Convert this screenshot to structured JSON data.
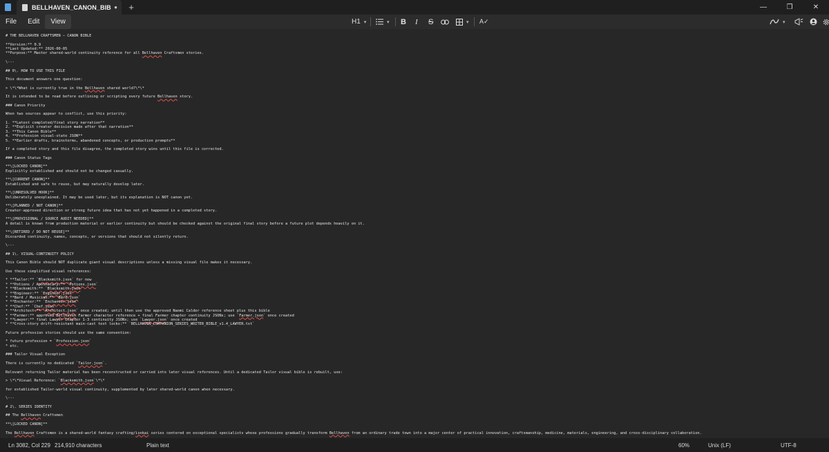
{
  "tab": {
    "title": "BELLHAVEN_CANON_BIBLE_UPDATI",
    "modified_dot": "●",
    "close": "✕",
    "add": "+"
  },
  "window": {
    "minimize": "—",
    "maximize": "❐",
    "close": "✕"
  },
  "menu": {
    "file": "File",
    "edit": "Edit",
    "view": "View"
  },
  "toolbar": {
    "heading": "H1",
    "bold": "B",
    "italic": "I",
    "strike": "S",
    "link": "⛓",
    "table": "⊞",
    "spellcheck": "A✓",
    "caret": "▾"
  },
  "icons": {
    "app": "notepad-icon",
    "list": "bullet-list-icon",
    "copilot": "copilot-icon",
    "settings": "gear-icon",
    "account": "account-icon",
    "share": "megaphone-icon"
  },
  "document": {
    "lines": [
      "# THE BELLHAVEN CRAFTSMEN — CANON BIBLE",
      "",
      "**Version:** 0.9",
      "**Last Updated:** 2026-00-05",
      "**Purpose:** Master shared-world continuity reference for all Bellhaven Craftsmen stories.",
      "",
      "\\---",
      "",
      "## 0\\. HOW TO USE THIS FILE",
      "",
      "This document answers one question:",
      "",
      "> \\*\\*What is currently true in the Bellhaven shared world?\\*\\*",
      "",
      "It is intended to be read before outlining or scripting every future Bellhaven story.",
      "",
      "### Canon Priority",
      "",
      "When two sources appear to conflict, use this priority:",
      "",
      "1. **Latest completed/final story narration**",
      "2. **Explicit creator decision made after that narration**",
      "3. **This Canon Bible**",
      "4. **Profession visual-state JSON**",
      "5. **Earlier drafts, brainstorms, abandoned concepts, or production prompts**",
      "",
      "If a completed story and this file disagree, the completed story wins until this file is corrected.",
      "",
      "### Canon Status Tags",
      "",
      "**\\[LOCKED CANON]**",
      "Explicitly established and should not be changed casually.",
      "",
      "**\\[CURRENT CANON]**",
      "Established and safe to reuse, but may naturally develop later.",
      "",
      "**\\[UNRESOLVED HOOK]**",
      "Deliberately unexplained. It may be used later, but its explanation is NOT canon yet.",
      "",
      "**\\[PLANNED / NOT CANON]**",
      "Creator-approved direction or strong future idea that has not yet happened in a completed story.",
      "",
      "**\\[PROVISIONAL / SOURCE AUDIT NEEDED]**",
      "A detail is known from production material or earlier continuity but should be checked against the original final story before a future plot depends heavily on it.",
      "",
      "**\\[RETIRED / DO NOT REUSE]**",
      "Discarded continuity, names, concepts, or versions that should not silently return.",
      "",
      "\\---",
      "",
      "## 1\\. VISUAL-CONTINUITY POLICY",
      "",
      "This Canon Bible should NOT duplicate giant visual descriptions unless a missing visual file makes it necessary.",
      "",
      "Use these simplified visual references:",
      "",
      "* **Tailor:** `Blacksmith.json` for now",
      "* **Potions / Apothecary:** `Potions.json`",
      "* **Blacksmith:** `Blacksmith.json`",
      "* **Engineer:** `Engineer.json`",
      "* **Bard / Musician:** `Bard.json`",
      "* **Enchanter:** `Enchanter.json`",
      "* **Chef:** `Chef.json`",
      "* **Architect:** `Architect.json` once created; until then use the approved Naomi Calder reference sheet plus this bible",
      "* **Farmer:** approved Bellhaven Farmer character reference + final Farmer chapter continuity JSONs; use `Farmer.json` once created",
      "* **Lawyer:** final Lawyer Chapter 1-3 continuity JSONs; use `Lawyer.json` once created",
      "* **Cross-story drift-resistant main-cast text locks:** `BELLHAVEN_COMPANION_SERIES_WRITER_BIBLE_v1.4_LAWYER.txt`",
      "",
      "Future profession stories should use the same convention:",
      "",
      "* future profession = `Profession.json`",
      "* etc.",
      "",
      "### Tailor Visual Exception",
      "",
      "There is currently no dedicated `Tailor.json`.",
      "",
      "Relevant returning Tailor material has been reconstructed or carried into later visual references. Until a dedicated Tailor visual bible is rebuilt, use:",
      "",
      "> \\*\\*Visual Reference: `Blacksmith.json`\\*\\*",
      "",
      "for established Tailor-world visual continuity, supplemented by later shared-world canon when necessary.",
      "",
      "\\---",
      "",
      "# 2\\. SERIES IDENTITY",
      "",
      "## The Bellhaven Craftsmen",
      "",
      "**\\[LOCKED CANON]**",
      "",
      "The Bellhaven Craftsmen is a shared-world fantasy crafting/isekai series centered on exceptional specialists whose professions gradually transform Bellhaven from an ordinary trade town into a major center of practical innovation, craftsmanship, medicine, materials, engineering, and cross-disciplinary collaboration."
    ]
  },
  "status": {
    "position": "Ln 3082, Col 229",
    "characters": "214,910 characters",
    "format": "Plain text",
    "zoom": "60%",
    "line_ending": "Unix (LF)",
    "encoding": "UTF-8"
  }
}
